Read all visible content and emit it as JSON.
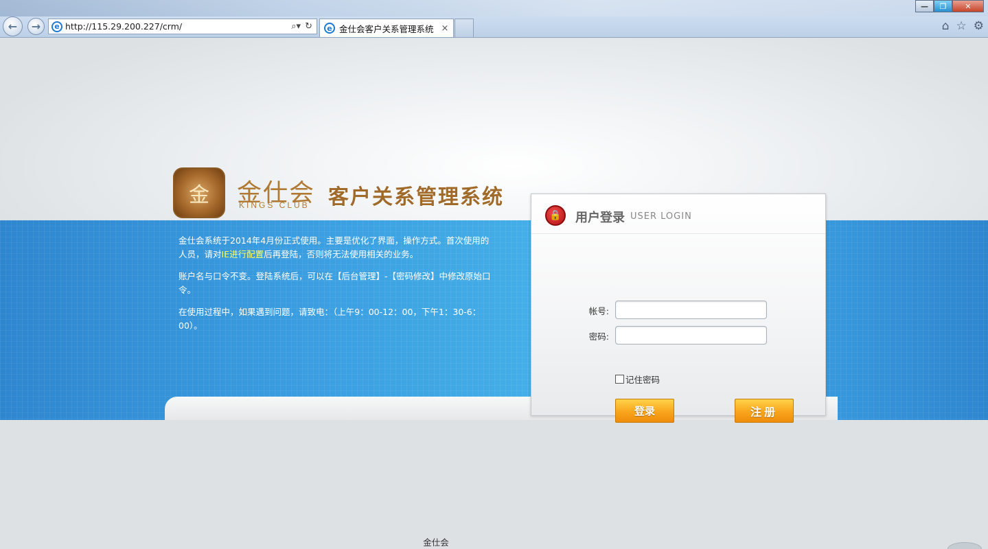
{
  "browser": {
    "url": "http://115.29.200.227/crm/",
    "tab_title": "金仕会客户关系管理系统",
    "tab_close": "×",
    "back": "←",
    "forward": "→",
    "addr_search": "⌕▾",
    "addr_refresh": "↻",
    "home": "⌂",
    "favorites": "☆",
    "settings": "⚙",
    "win_min": "—",
    "win_max": "❐",
    "win_close": "✕",
    "ie_letter": "e"
  },
  "brand": {
    "logo_glyph": "金",
    "name_cn": "金仕会",
    "name_en": "KINGS CLUB",
    "system_title": "客户关系管理系统"
  },
  "info": {
    "para1_a": "金仕会系统于2014年4月份正式使用。主要是优化了界面，操作方式。首次使用的人员，请对",
    "para1_link": "IE进行配置",
    "para1_b": "后再登陆，否则将无法使用相关的业务。",
    "para2": "账户名与口令不变。登陆系统后，可以在【后台管理】-【密码修改】中修改原始口令。",
    "para3": "在使用过程中，如果遇到问题，请致电：（上午9：00-12：00，下午1：30-6：00）。"
  },
  "login": {
    "title": "用户登录",
    "subtitle": "USER LOGIN",
    "lock_icon": "🔒",
    "username_label": "帐号:",
    "password_label": "密码:",
    "username_value": "",
    "password_value": "",
    "remember_label": "记住密码",
    "login_button": "登录",
    "register_button": "注册"
  },
  "footer": {
    "text": "金仕会"
  },
  "colors": {
    "band_blue": "#3a9de0",
    "button_orange": "#f8a51c",
    "brand_gold": "#b07a35",
    "highlight_yellow": "#ffff66"
  }
}
